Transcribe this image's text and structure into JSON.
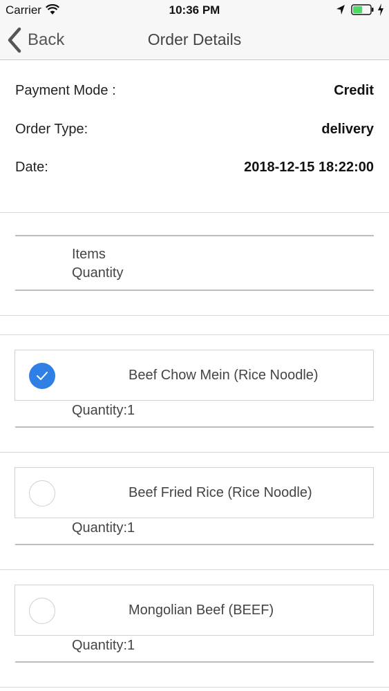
{
  "status_bar": {
    "carrier": "Carrier",
    "time": "10:36 PM",
    "icons": [
      "wifi-icon",
      "location-icon",
      "battery-icon",
      "charging-icon"
    ],
    "battery_level": 0.55
  },
  "nav": {
    "back_label": "Back",
    "title": "Order Details"
  },
  "order": {
    "payment_mode_label": "Payment Mode :",
    "payment_mode_value": "Credit",
    "order_type_label": "Order Type:",
    "order_type_value": "delivery",
    "date_label": "Date:",
    "date_value": "2018-12-15 18:22:00"
  },
  "list_header": {
    "items_label": "Items",
    "quantity_label": "Quantity"
  },
  "items": [
    {
      "name": "Beef Chow Mein (Rice Noodle)",
      "quantity": "Quantity:1",
      "checked": true
    },
    {
      "name": "Beef Fried Rice (Rice Noodle)",
      "quantity": "Quantity:1",
      "checked": false
    },
    {
      "name": "Mongolian Beef (BEEF)",
      "quantity": "Quantity:1",
      "checked": false
    }
  ],
  "colors": {
    "accent": "#2f7fe4",
    "bar_background": "#f7f7f7",
    "battery_green": "#4cd964"
  }
}
